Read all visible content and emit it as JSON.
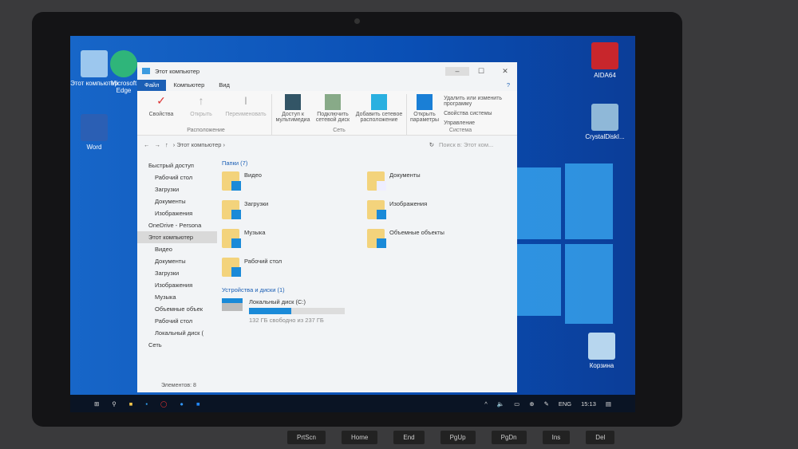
{
  "desktop": {
    "icons": [
      {
        "label": "Этот компьютер"
      },
      {
        "label": "Microsoft Edge"
      },
      {
        "label": "Word"
      },
      {
        "label": "AIDA64"
      },
      {
        "label": "CrystalDiskI..."
      },
      {
        "label": "Корзина"
      }
    ]
  },
  "window": {
    "title": "Этот компьютер",
    "tabs": [
      "Файл",
      "Компьютер",
      "Вид"
    ],
    "ribbon": {
      "groups": [
        {
          "label": "Расположение",
          "buttons": [
            "Свойства",
            "Открыть",
            "Переименовать"
          ]
        },
        {
          "label": "Сеть",
          "buttons": [
            "Доступ к мультимедиа",
            "Подключить сетевой диск",
            "Добавить сетевое расположение"
          ]
        },
        {
          "label": "Система",
          "buttons": [
            "Открыть параметры"
          ],
          "small": [
            "Удалить или изменить программу",
            "Свойства системы",
            "Управление"
          ]
        }
      ]
    },
    "address": {
      "path": "Этот компьютер",
      "search_placeholder": "Поиск в: Этот ком..."
    },
    "nav": [
      {
        "label": "Быстрый доступ"
      },
      {
        "label": "Рабочий стол"
      },
      {
        "label": "Загрузки"
      },
      {
        "label": "Документы"
      },
      {
        "label": "Изображения"
      },
      {
        "label": "OneDrive - Persona"
      },
      {
        "label": "Этот компьютер"
      },
      {
        "label": "Видео"
      },
      {
        "label": "Документы"
      },
      {
        "label": "Загрузки"
      },
      {
        "label": "Изображения"
      },
      {
        "label": "Музыка"
      },
      {
        "label": "Объемные объек"
      },
      {
        "label": "Рабочий стол"
      },
      {
        "label": "Локальный диск ("
      },
      {
        "label": "Сеть"
      }
    ],
    "folders_header": "Папки (7)",
    "folders": [
      "Видео",
      "Документы",
      "Загрузки",
      "Изображения",
      "Музыка",
      "Объемные объекты",
      "Рабочий стол"
    ],
    "devices_header": "Устройства и диски (1)",
    "drive": {
      "name": "Локальный диск (C:)",
      "free_text": "132 ГБ свободно из 237 ГБ",
      "used_fraction": 0.44
    },
    "status": "Элементов: 8"
  },
  "taskbar": {
    "lang": "ENG",
    "time": "15:13"
  },
  "keyboard": [
    "PrtScn",
    "Home",
    "End",
    "PgUp",
    "PgDn",
    "Ins",
    "Del"
  ]
}
